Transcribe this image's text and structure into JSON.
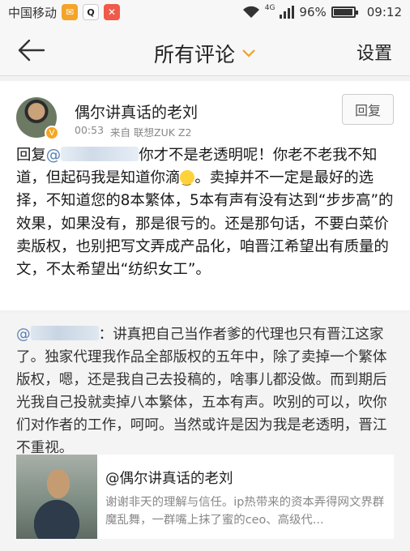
{
  "status_bar": {
    "carrier": "中国移动",
    "network": "4G",
    "battery": "96%",
    "battery_level": 0.96,
    "time": "09:12",
    "notification_icons": [
      "app-notification-icon",
      "qq-icon",
      "app-notification-icon-2"
    ]
  },
  "header": {
    "title": "所有评论",
    "settings_label": "设置"
  },
  "comment": {
    "username": "偶尔讲真话的老刘",
    "time": "00:53",
    "source": "来自 联想ZUK Z2",
    "reply_label": "回复",
    "reply_prefix": "回复",
    "mention_at": "@",
    "body_part1": "你才不是老透明呢！你老不老我不知道，但起码我是知道你滴",
    "body_part2": "。卖掉并不一定是最好的选择，不知道您的8本繁体，5本有声有没有达到“步步高”的效果，如果没有，那是很亏的。还是那句话，不要白菜价卖版权，也别把写文弄成产品化，咱晋江希望出有质量的文，不太希望出“纺织女工”。"
  },
  "quote": {
    "mention_at": "@",
    "text": "：讲真把自己当作者爹的代理也只有晋江这家了。独家代理我作品全部版权的五年中，除了卖掉一个繁体版权，嗯，还是我自己去投稿的，啥事儿都没做。而到期后光我自己投就卖掉八本繁体，五本有声。吹别的可以，吹你们对作者的工作，呵呵。当然或许是因为我是老透明，晋江不重视。",
    "share_title": "@偶尔讲真话的老刘",
    "share_desc": "谢谢非天的理解与信任。ip热带来的资本弄得网文界群魔乱舞，一群嘴上抹了蜜的ceo、高级代..."
  },
  "colors": {
    "accent": "#f0a020",
    "mention": "#5580b5"
  }
}
